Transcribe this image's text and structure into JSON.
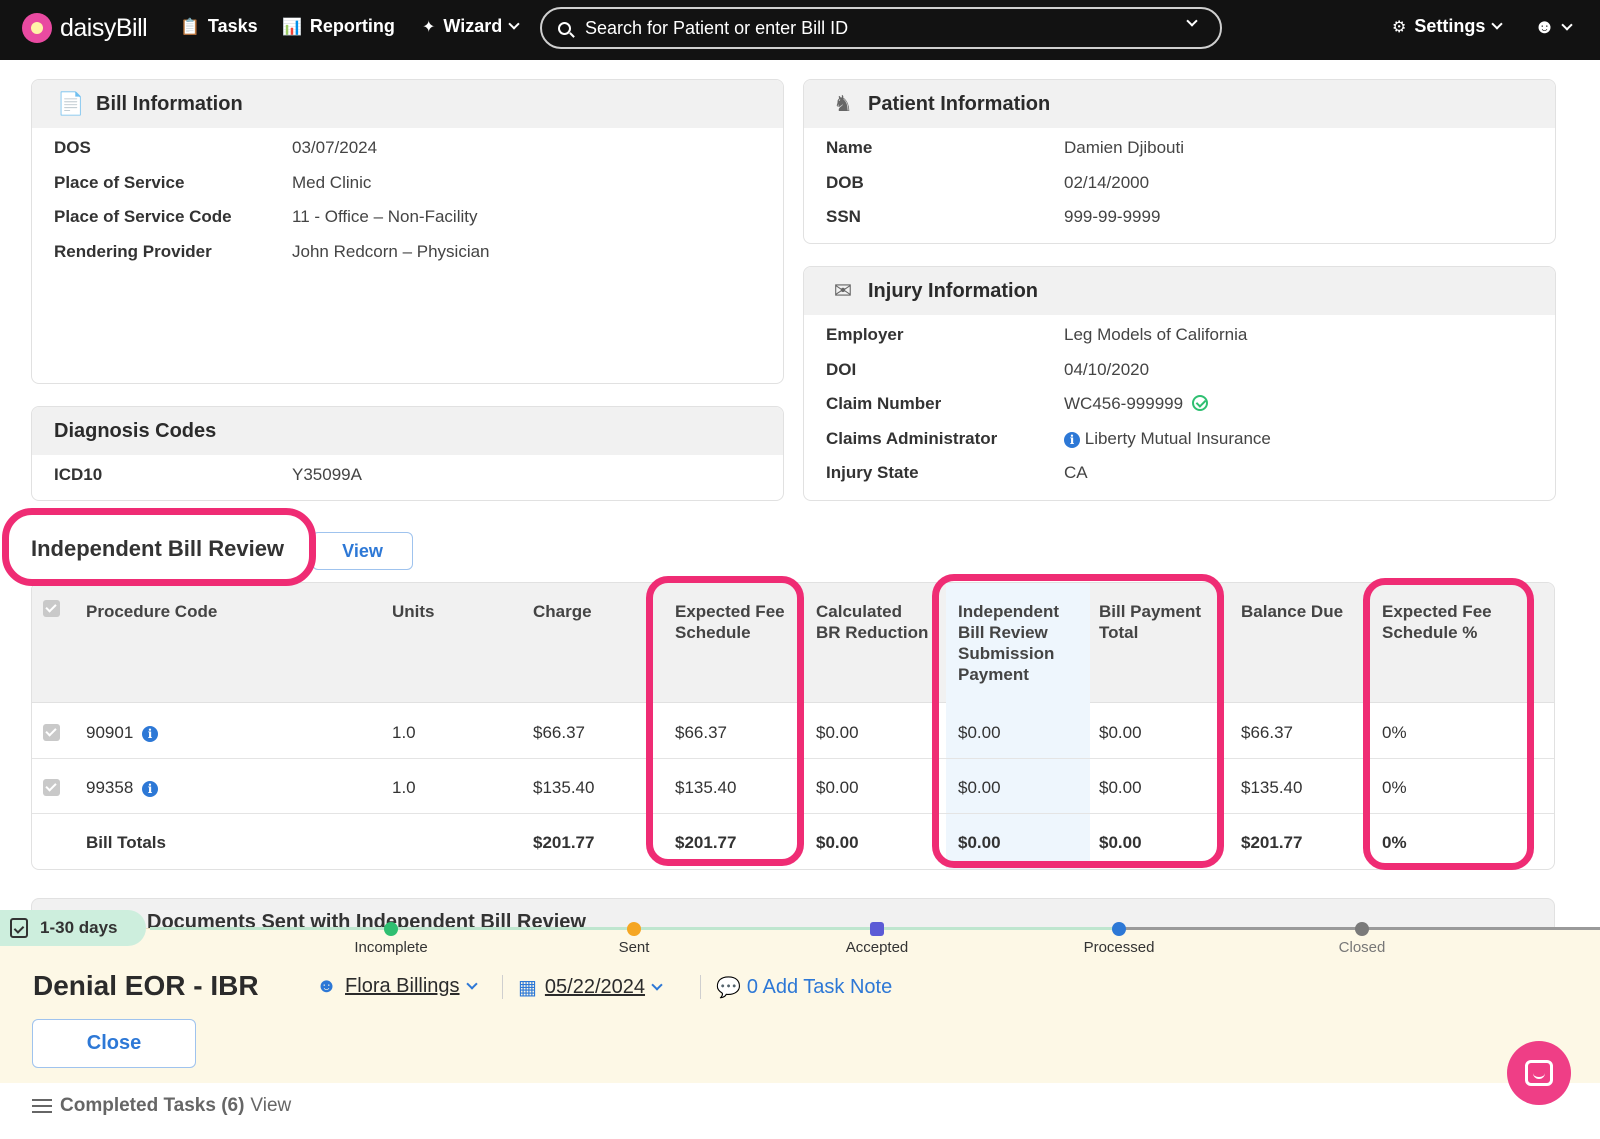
{
  "nav": {
    "brand": "daisyBill",
    "tasks": "Tasks",
    "reporting": "Reporting",
    "wizard": "Wizard",
    "search_placeholder": "Search for Patient or enter Bill ID",
    "settings": "Settings"
  },
  "bill_info": {
    "title": "Bill Information",
    "rows": [
      {
        "label": "DOS",
        "value": "03/07/2024"
      },
      {
        "label": "Place of Service",
        "value": "Med Clinic"
      },
      {
        "label": "Place of Service Code",
        "value": "11 - Office – Non-Facility"
      },
      {
        "label": "Rendering Provider",
        "value": "John Redcorn – Physician"
      }
    ]
  },
  "patient_info": {
    "title": "Patient Information",
    "rows": [
      {
        "label": "Name",
        "value": "Damien Djibouti"
      },
      {
        "label": "DOB",
        "value": "02/14/2000"
      },
      {
        "label": "SSN",
        "value": "999-99-9999"
      }
    ]
  },
  "injury_info": {
    "title": "Injury Information",
    "rows": [
      {
        "label": "Employer",
        "value": "Leg Models of California"
      },
      {
        "label": "DOI",
        "value": "04/10/2020"
      },
      {
        "label": "Claim Number",
        "value": "WC456-999999"
      },
      {
        "label": "Claims Administrator",
        "value": "Liberty Mutual Insurance"
      },
      {
        "label": "Injury State",
        "value": "CA"
      }
    ]
  },
  "diagnosis": {
    "title": "Diagnosis Codes",
    "label": "ICD10",
    "value": "Y35099A"
  },
  "ibr": {
    "title": "Independent Bill Review",
    "view_label": "View",
    "headers": {
      "procedure_code": "Procedure Code",
      "units": "Units",
      "charge": "Charge",
      "expected_fee_1": "Expected Fee",
      "expected_fee_2": "Schedule",
      "calc_br_1": "Calculated",
      "calc_br_2": "BR Reduction",
      "ibr_payment_1": "Independent",
      "ibr_payment_2": "Bill Review",
      "ibr_payment_3": "Submission",
      "ibr_payment_4": "Payment",
      "bill_payment_1": "Bill Payment",
      "bill_payment_2": "Total",
      "balance_due": "Balance Due",
      "expected_pct_1": "Expected Fee",
      "expected_pct_2": "Schedule %"
    },
    "rows": [
      {
        "code": "90901",
        "units": "1.0",
        "charge": "$66.37",
        "expected_fee": "$66.37",
        "br_reduction": "$0.00",
        "ibr_payment": "$0.00",
        "bill_payment": "$0.00",
        "balance_due": "$66.37",
        "expected_pct": "0%"
      },
      {
        "code": "99358",
        "units": "1.0",
        "charge": "$135.40",
        "expected_fee": "$135.40",
        "br_reduction": "$0.00",
        "ibr_payment": "$0.00",
        "bill_payment": "$0.00",
        "balance_due": "$135.40",
        "expected_pct": "0%"
      }
    ],
    "totals": {
      "label": "Bill Totals",
      "charge": "$201.77",
      "expected_fee": "$201.77",
      "br_reduction": "$0.00",
      "ibr_payment": "$0.00",
      "bill_payment": "$0.00",
      "balance_due": "$201.77",
      "expected_pct": "0%"
    }
  },
  "docs_sent": {
    "title": "Documents Sent with Independent Bill Review"
  },
  "task_panel": {
    "days_badge": "1-30 days",
    "steps": [
      "Incomplete",
      "Sent",
      "Accepted",
      "Processed",
      "Closed"
    ],
    "title": "Denial EOR - IBR",
    "assignee": "Flora Billings",
    "date": "05/22/2024",
    "task_note": "0 Add Task Note",
    "close_label": "Close",
    "completed_label": "Completed Tasks (6)",
    "completed_view": "View"
  },
  "colors": {
    "accent": "#2d78d6",
    "highlight": "#ef2c74",
    "nav_bg": "#121212",
    "panel_bg": "#fdf8e6"
  }
}
